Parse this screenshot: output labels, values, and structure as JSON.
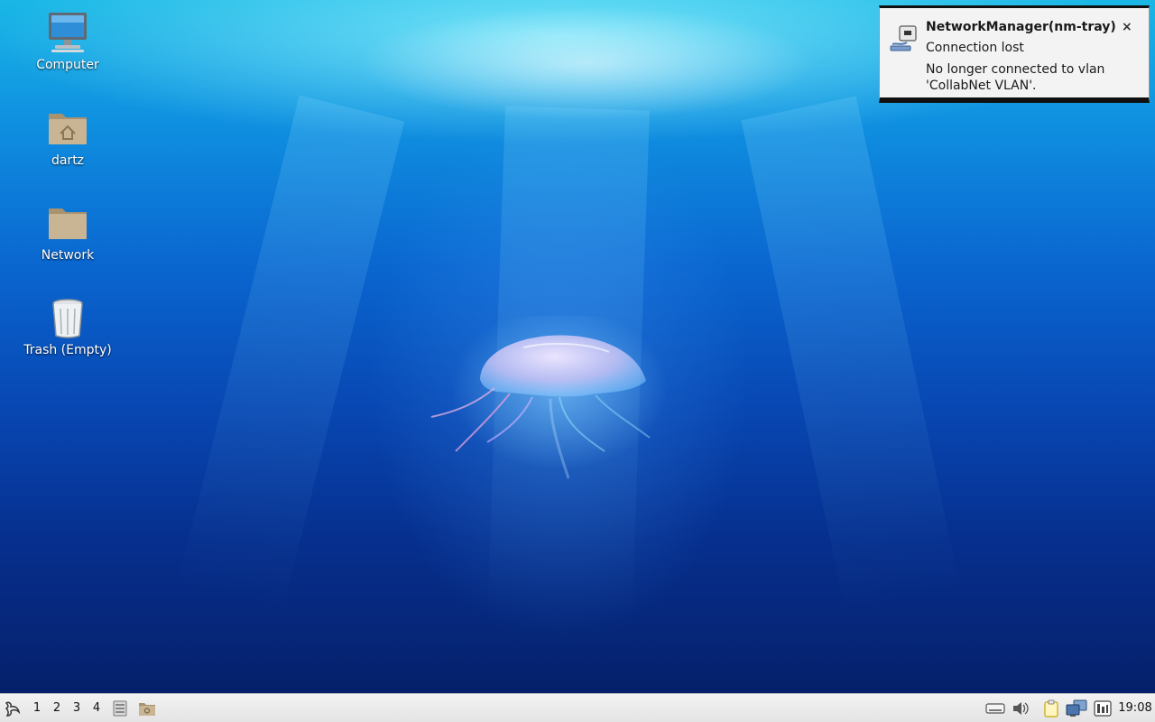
{
  "desktop": {
    "icons": [
      {
        "label": "Computer",
        "icon": "computer-icon"
      },
      {
        "label": "dartz",
        "icon": "home-folder-icon"
      },
      {
        "label": "Network",
        "icon": "folder-icon"
      },
      {
        "label": "Trash (Empty)",
        "icon": "trash-icon"
      }
    ]
  },
  "notification": {
    "app": "NetworkManager(nm-tray)",
    "summary": "Connection lost",
    "body": "No longer connected to vlan 'CollabNet VLAN'.",
    "close": "×",
    "icon": "network-wired-icon"
  },
  "taskbar": {
    "menu_icon": "start-menu-icon",
    "workspaces": [
      "1",
      "2",
      "3",
      "4"
    ],
    "launchers": [
      "file-manager-launcher-icon",
      "folder-launcher-icon"
    ],
    "tray": [
      "keyboard-icon",
      "volume-icon",
      "clipboard-icon",
      "network-tray-icon",
      "cpu-monitor-icon"
    ],
    "clock": "19:08"
  },
  "colors": {
    "sky_top": "#19b7e6",
    "deep": "#05206a",
    "folder": "#c9b493",
    "taskbar": "#ebebeb"
  }
}
